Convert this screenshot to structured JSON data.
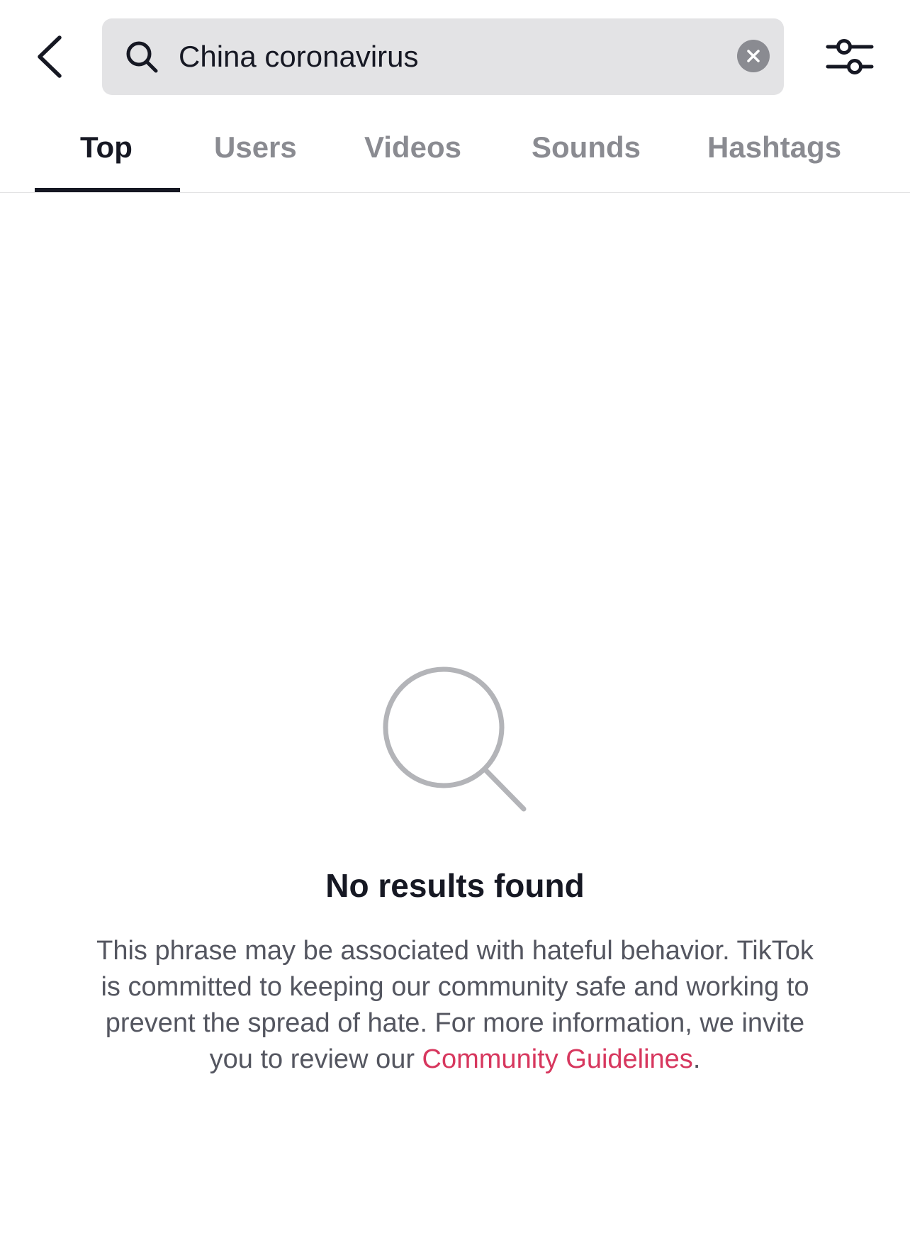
{
  "search": {
    "query": "China coronavirus",
    "icon": "search-icon",
    "clear_icon": "clear-icon"
  },
  "header": {
    "back_icon": "back-arrow-icon",
    "filter_icon": "filter-sliders-icon"
  },
  "tabs": [
    {
      "label": "Top",
      "active": true
    },
    {
      "label": "Users",
      "active": false
    },
    {
      "label": "Videos",
      "active": false
    },
    {
      "label": "Sounds",
      "active": false
    },
    {
      "label": "Hashtags",
      "active": false
    }
  ],
  "empty_state": {
    "icon": "magnifier-icon",
    "title": "No results found",
    "message": "This phrase may be associated with hateful behavior. TikTok is committed to keeping our community safe and working to prevent the spread of hate. For more information, we invite you to review our ",
    "link_text": "Community Guidelines",
    "trailing": "."
  },
  "colors": {
    "text_primary": "#161823",
    "text_secondary": "#8a8b91",
    "link": "#d7375e",
    "search_bg": "#e3e3e5"
  }
}
